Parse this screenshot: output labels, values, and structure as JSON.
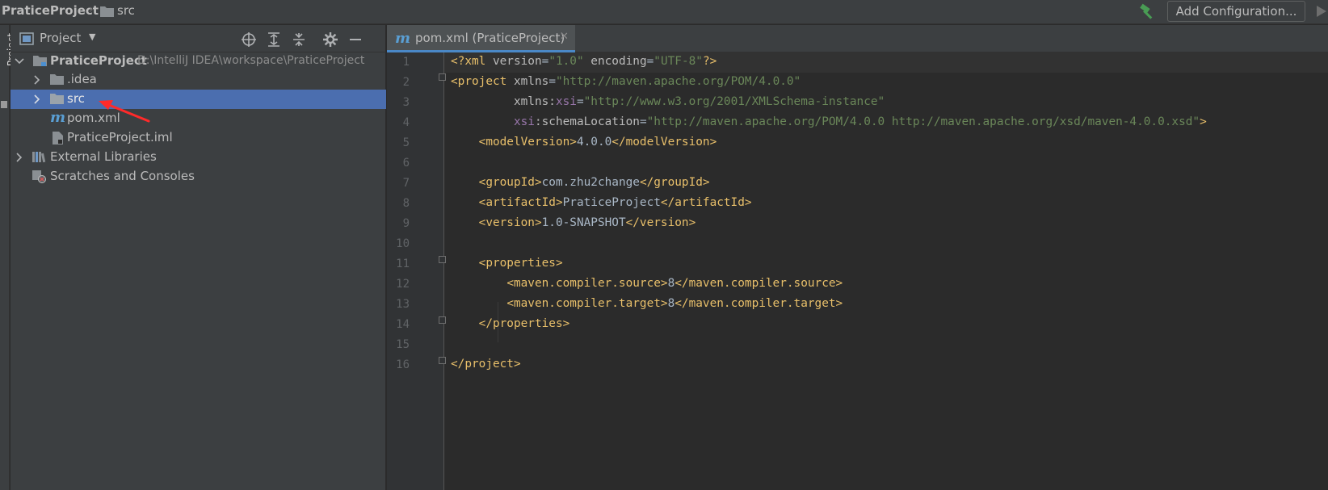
{
  "breadcrumb": {
    "project": "PraticeProject",
    "folder": "src"
  },
  "toolbar": {
    "add_configuration": "Add Configuration..."
  },
  "toolstrip": {
    "label": "Project"
  },
  "project_panel": {
    "title": "Project",
    "tree": {
      "root": {
        "label": "PraticeProject",
        "path": "D:\\IntelliJ IDEA\\workspace\\PraticeProject"
      },
      "idea": {
        "label": ".idea"
      },
      "src": {
        "label": "src"
      },
      "pom": {
        "label": "pom.xml"
      },
      "iml": {
        "label": "PraticeProject.iml"
      },
      "ext": {
        "label": "External Libraries"
      },
      "scratches": {
        "label": "Scratches and Consoles"
      }
    }
  },
  "editor": {
    "tab": {
      "label": "pom.xml (PraticeProject)"
    },
    "line_numbers": [
      "1",
      "2",
      "3",
      "4",
      "5",
      "6",
      "7",
      "8",
      "9",
      "10",
      "11",
      "12",
      "13",
      "14",
      "15",
      "16"
    ],
    "lines": {
      "l1": {
        "a": "<?xml ",
        "b": "version",
        "c": "=",
        "d": "\"1.0\"",
        "e": " encoding",
        "f": "=",
        "g": "\"UTF-8\"",
        "h": "?>"
      },
      "l2": {
        "a": "<project ",
        "b": "xmlns",
        "c": "=",
        "d": "\"http://maven.apache.org/POM/4.0.0\""
      },
      "l3": {
        "pre": "         ",
        "b": "xmlns:",
        "n": "xsi",
        "c": "=",
        "d": "\"http://www.w3.org/2001/XMLSchema-instance\""
      },
      "l4": {
        "pre": "         ",
        "n": "xsi",
        "b": ":schemaLocation",
        "c": "=",
        "d": "\"http://maven.apache.org/POM/4.0.0 http://maven.apache.org/xsd/maven-4.0.0.xsd\"",
        "e": ">"
      },
      "l5": {
        "pre": "    ",
        "o": "<modelVersion>",
        "v": "4.0.0",
        "c": "</modelVersion>"
      },
      "l7": {
        "pre": "    ",
        "o": "<groupId>",
        "v": "com.zhu2change",
        "c": "</groupId>"
      },
      "l8": {
        "pre": "    ",
        "o": "<artifactId>",
        "v": "PraticeProject",
        "c": "</artifactId>"
      },
      "l9": {
        "pre": "    ",
        "o": "<version>",
        "v": "1.0-SNAPSHOT",
        "c": "</version>"
      },
      "l11": {
        "pre": "    ",
        "o": "<properties>"
      },
      "l12": {
        "pre": "        ",
        "o": "<maven.compiler.source>",
        "v": "8",
        "c": "</maven.compiler.source>"
      },
      "l13": {
        "pre": "        ",
        "o": "<maven.compiler.target>",
        "v": "8",
        "c": "</maven.compiler.target>"
      },
      "l14": {
        "pre": "    ",
        "c": "</properties>"
      },
      "l16": {
        "c": "</project>"
      }
    }
  },
  "colors": {
    "background": "#2b2b2b",
    "panel": "#3c3f41",
    "selection": "#4b6eaf",
    "xml_tag": "#e8bf6a",
    "xml_value": "#6a8759",
    "xml_namespace": "#9876aa",
    "annotation_arrow": "#ff2a2a"
  }
}
